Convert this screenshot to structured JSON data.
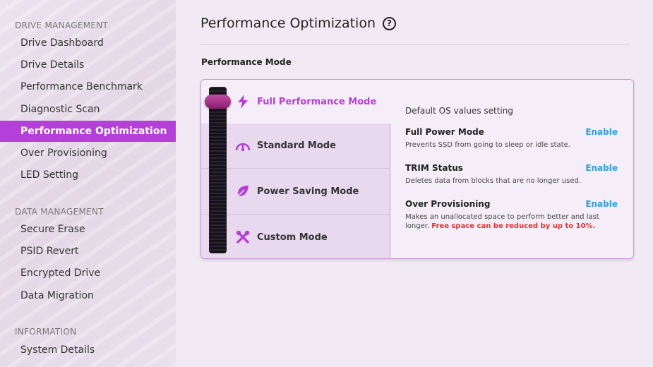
{
  "sidebar": {
    "sections": [
      {
        "title": "DRIVE MANAGEMENT",
        "items": [
          "Drive Dashboard",
          "Drive Details",
          "Performance Benchmark",
          "Diagnostic Scan",
          "Performance Optimization",
          "Over Provisioning",
          "LED Setting"
        ]
      },
      {
        "title": "DATA MANAGEMENT",
        "items": [
          "Secure Erase",
          "PSID Revert",
          "Encrypted Drive",
          "Data Migration"
        ]
      },
      {
        "title": "INFORMATION",
        "items": [
          "System Details"
        ]
      }
    ],
    "active_item": "Performance Optimization"
  },
  "main": {
    "title": "Performance Optimization",
    "help_glyph": "?",
    "section_label": "Performance Mode",
    "modes": [
      {
        "label": "Full Performance Mode",
        "icon": "lightning-icon"
      },
      {
        "label": "Standard Mode",
        "icon": "gauge-icon"
      },
      {
        "label": "Power Saving Mode",
        "icon": "leaf-icon"
      },
      {
        "label": "Custom Mode",
        "icon": "tools-icon"
      }
    ],
    "selected_mode_index": 0,
    "details": {
      "default_text": "Default OS values setting",
      "settings": [
        {
          "name": "Full Power Mode",
          "action": "Enable",
          "desc": "Prevents SSD from going to sleep or idle state.",
          "warning": ""
        },
        {
          "name": "TRIM Status",
          "action": "Enable",
          "desc": "Deletes data from blocks that are no longer used.",
          "warning": ""
        },
        {
          "name": "Over Provisioning",
          "action": "Enable",
          "desc": "Makes an unallocated space to perform better and last longer.",
          "warning": "Free space can be reduced by up to 10%."
        }
      ]
    }
  },
  "colors": {
    "accent": "#b53fd9",
    "link": "#2c9ee0",
    "warning": "#e0302f"
  }
}
